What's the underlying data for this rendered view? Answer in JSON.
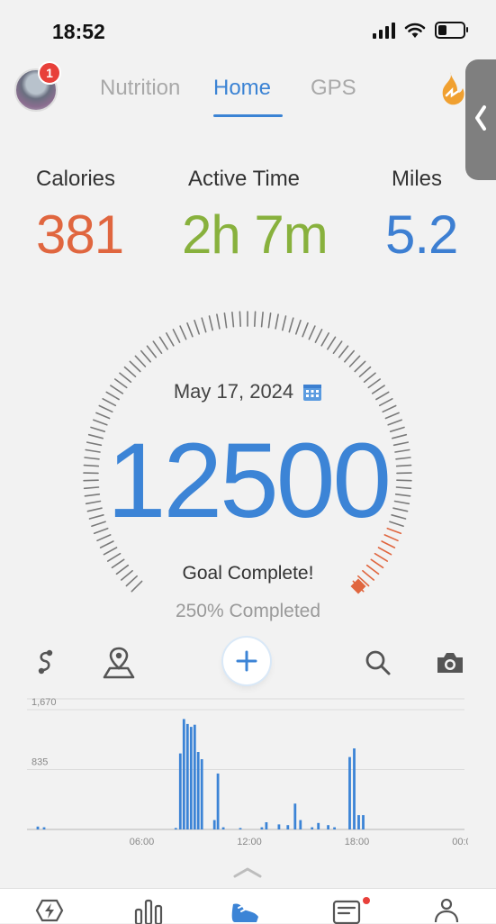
{
  "status_bar": {
    "time": "18:52"
  },
  "header": {
    "notification_count": "1",
    "tabs": [
      {
        "label": "Nutrition",
        "active": false
      },
      {
        "label": "Home",
        "active": true
      },
      {
        "label": "GPS",
        "active": false
      }
    ]
  },
  "stats": {
    "calories": {
      "label": "Calories",
      "value": "381"
    },
    "active_time": {
      "label": "Active Time",
      "value": "2h 7m"
    },
    "miles": {
      "label": "Miles",
      "value": "5.2"
    }
  },
  "gauge": {
    "date": "May 17, 2024",
    "steps": "12500",
    "goal_text": "Goal Complete!",
    "percent_text": "250% Completed",
    "percent_complete": 2.5
  },
  "toolbar": {
    "icons": [
      "route-icon",
      "map-pin-icon",
      "add-icon",
      "search-icon",
      "camera-icon"
    ]
  },
  "colors": {
    "accent": "#3c84d6",
    "calories": "#e0663f",
    "active_time": "#88b13d",
    "miles": "#3d7fd2",
    "gauge_tick": "#7a7a7a",
    "gauge_end": "#e0663f"
  },
  "chart_data": {
    "type": "bar",
    "y_ticks": [
      "1,670",
      "835"
    ],
    "y_tick_values": [
      1670,
      835
    ],
    "x_ticks": [
      "06:00",
      "12:00",
      "18:00",
      "00:00"
    ],
    "ylim": [
      0,
      1670
    ],
    "x_hours_range": [
      0,
      24
    ],
    "bars": [
      {
        "h": 0.2,
        "v": 40
      },
      {
        "h": 0.55,
        "v": 30
      },
      {
        "h": 7.9,
        "v": 20
      },
      {
        "h": 8.15,
        "v": 1060
      },
      {
        "h": 8.35,
        "v": 1540
      },
      {
        "h": 8.55,
        "v": 1470
      },
      {
        "h": 8.75,
        "v": 1430
      },
      {
        "h": 8.95,
        "v": 1460
      },
      {
        "h": 9.15,
        "v": 1080
      },
      {
        "h": 9.35,
        "v": 980
      },
      {
        "h": 10.05,
        "v": 130
      },
      {
        "h": 10.25,
        "v": 780
      },
      {
        "h": 10.55,
        "v": 30
      },
      {
        "h": 11.5,
        "v": 20
      },
      {
        "h": 12.7,
        "v": 30
      },
      {
        "h": 12.95,
        "v": 100
      },
      {
        "h": 13.65,
        "v": 70
      },
      {
        "h": 14.15,
        "v": 60
      },
      {
        "h": 14.55,
        "v": 360
      },
      {
        "h": 14.85,
        "v": 130
      },
      {
        "h": 15.5,
        "v": 30
      },
      {
        "h": 15.85,
        "v": 90
      },
      {
        "h": 16.4,
        "v": 60
      },
      {
        "h": 16.75,
        "v": 30
      },
      {
        "h": 17.6,
        "v": 1010
      },
      {
        "h": 17.85,
        "v": 1130
      },
      {
        "h": 18.1,
        "v": 200
      },
      {
        "h": 18.35,
        "v": 200
      }
    ]
  }
}
